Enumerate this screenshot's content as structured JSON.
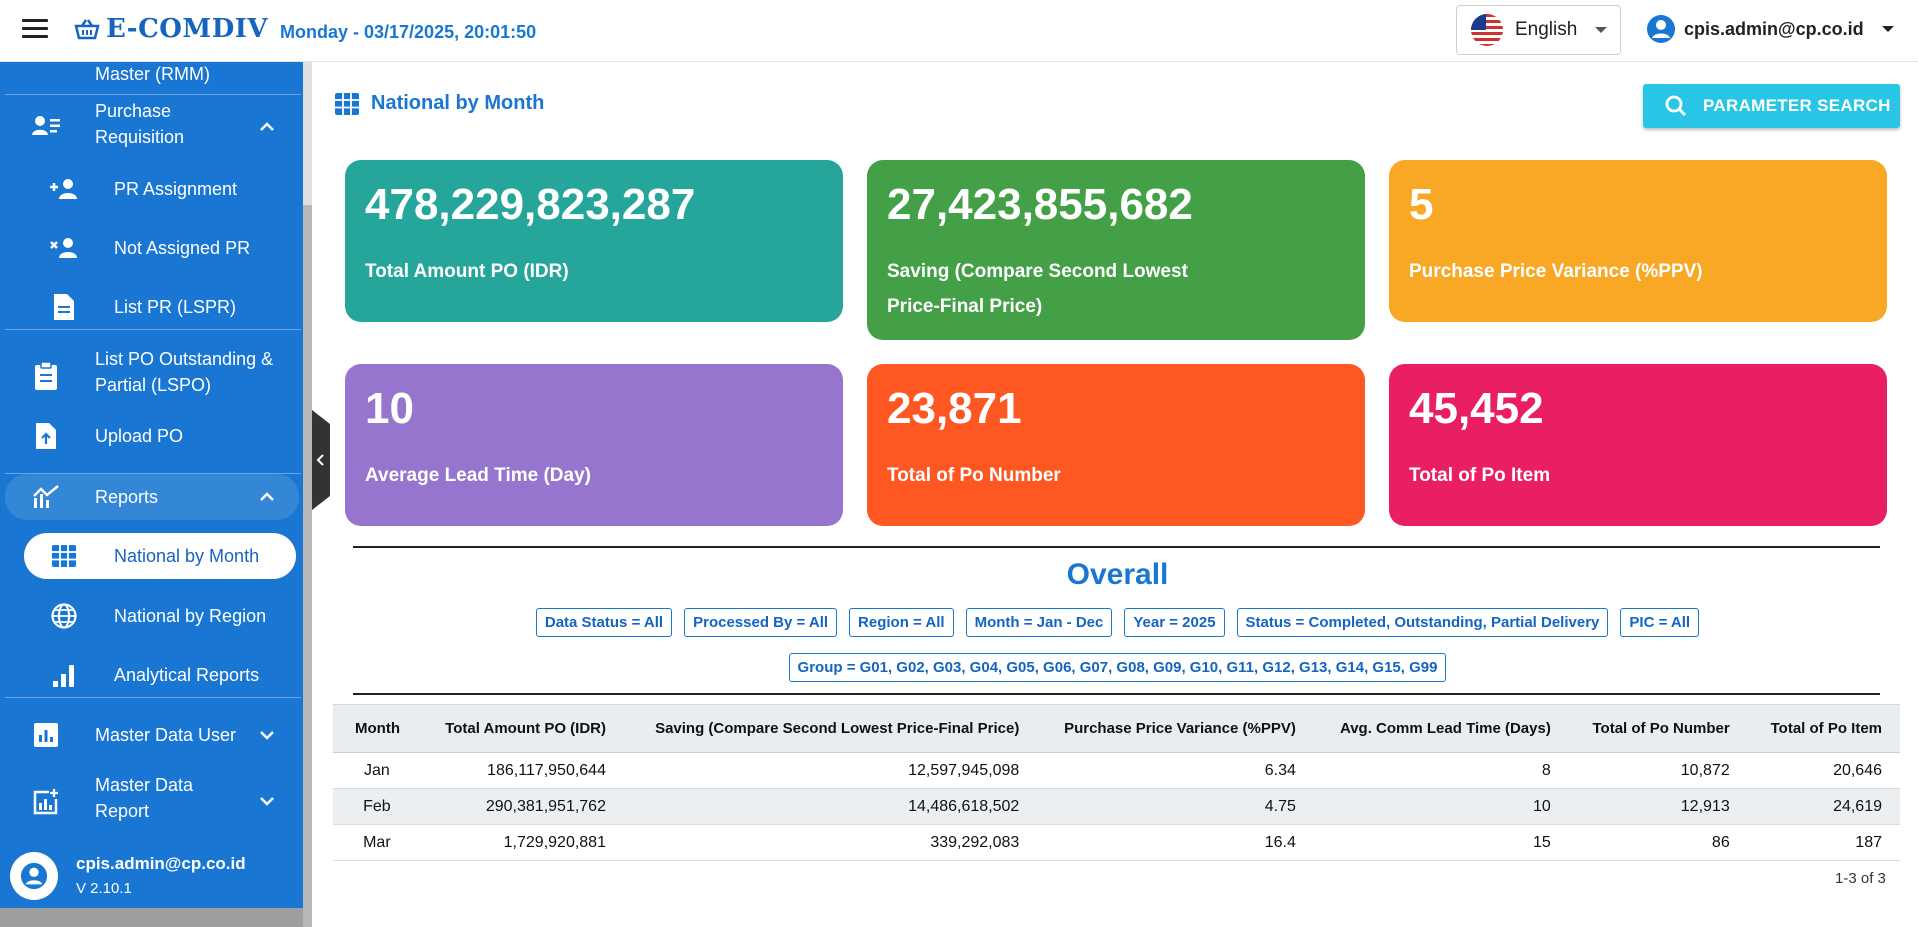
{
  "header": {
    "brand": "E-COMDIV",
    "datetime": "Monday - 03/17/2025, 20:01:50",
    "language": "English",
    "user": "cpis.admin@cp.co.id"
  },
  "sidebar": {
    "items": [
      {
        "label": "Master (RMM)"
      },
      {
        "label_line1": "Purchase",
        "label_line2": "Requisition"
      },
      {
        "label": "PR Assignment"
      },
      {
        "label": "Not Assigned PR"
      },
      {
        "label": "List PR (LSPR)"
      },
      {
        "label_line1": "List PO Outstanding &",
        "label_line2": "Partial (LSPO)"
      },
      {
        "label": "Upload PO"
      },
      {
        "label": "Reports"
      },
      {
        "label": "National by Month"
      },
      {
        "label": "National by Region"
      },
      {
        "label": "Analytical Reports"
      },
      {
        "label": "Master Data User"
      },
      {
        "label_line1": "Master Data",
        "label_line2": "Report"
      }
    ],
    "footer": {
      "user": "cpis.admin@cp.co.id",
      "version": "V 2.10.1"
    }
  },
  "page": {
    "title": "National by Month",
    "param_button": "PARAMETER SEARCH"
  },
  "cards": [
    {
      "value": "478,229,823,287",
      "caption": "Total Amount PO (IDR)",
      "color": "#26a69a"
    },
    {
      "value": "27,423,855,682",
      "caption": "Saving (Compare Second Lowest Price-Final Price)",
      "color": "#43a047"
    },
    {
      "value": "5",
      "caption": "Purchase Price Variance (%PPV)",
      "color": "#f9a825"
    },
    {
      "value": "10",
      "caption": "Average Lead Time (Day)",
      "color": "#9575cd"
    },
    {
      "value": "23,871",
      "caption": "Total of Po Number",
      "color": "#ff5722"
    },
    {
      "value": "45,452",
      "caption": "Total of Po Item",
      "color": "#e91e63"
    }
  ],
  "overall": {
    "title": "Overall",
    "filters": [
      "Data Status = All",
      "Processed By = All",
      "Region = All",
      "Month = Jan - Dec",
      "Year = 2025",
      "Status = Completed, Outstanding, Partial Delivery",
      "PIC = All"
    ],
    "group_filter": "Group = G01, G02, G03, G04, G05, G06, G07, G08, G09, G10, G11, G12, G13, G14, G15, G99"
  },
  "table": {
    "columns": [
      "Month",
      "Total Amount PO (IDR)",
      "Saving (Compare Second Lowest Price-Final Price)",
      "Purchase Price Variance (%PPV)",
      "Avg. Comm Lead Time (Days)",
      "Total of Po Number",
      "Total of Po Item"
    ],
    "rows": [
      [
        "Jan",
        "186,117,950,644",
        "12,597,945,098",
        "6.34",
        "8",
        "10,872",
        "20,646"
      ],
      [
        "Feb",
        "290,381,951,762",
        "14,486,618,502",
        "4.75",
        "10",
        "12,913",
        "24,619"
      ],
      [
        "Mar",
        "1,729,920,881",
        "339,292,083",
        "16.4",
        "15",
        "86",
        "187"
      ]
    ],
    "pagination": "1-3 of 3"
  },
  "colors": {
    "primary": "#1976d2",
    "accent": "#29c5e6"
  }
}
